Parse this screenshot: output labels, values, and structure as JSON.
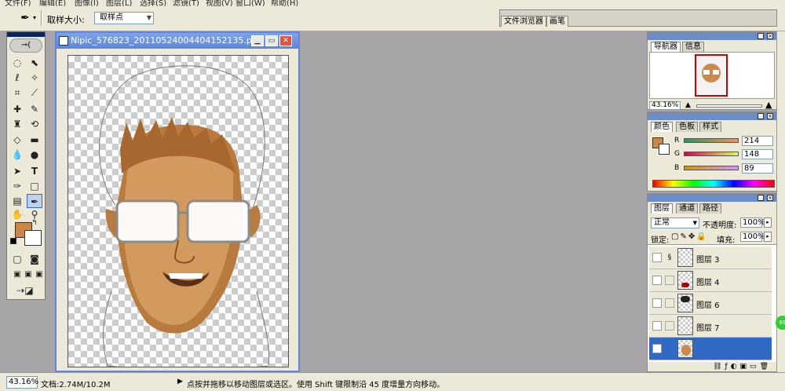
{
  "menu": [
    "文件(F)",
    "编辑(E)",
    "图像(I)",
    "图层(L)",
    "选择(S)",
    "滤镜(T)",
    "视图(V)",
    "窗口(W)",
    "帮助(H)"
  ],
  "options": {
    "label": "取样大小:",
    "sample_value": "取样点"
  },
  "well_tabs": [
    "文件浏览器",
    "画笔"
  ],
  "document": {
    "title": "Nipic_576823_20110524004404152135.psd..."
  },
  "status": {
    "zoom": "43.16%",
    "doc_size": "文档:2.74M/10.2M",
    "tip": "点按并拖移以移动图层或选区。使用 Shift 键限制沿 45 度增量方向移动。"
  },
  "navigator": {
    "tabs": [
      "导航器",
      "信息"
    ],
    "zoom": "43.16%"
  },
  "color": {
    "tabs": [
      "颜色",
      "色板",
      "样式"
    ],
    "r_label": "R",
    "g_label": "G",
    "b_label": "B",
    "r": "214",
    "g": "148",
    "b": "89",
    "fg_color": "#c9874c"
  },
  "layers": {
    "tabs": [
      "图层",
      "通道",
      "路径"
    ],
    "blend_mode": "正常",
    "opacity_label": "不透明度:",
    "opacity": "100%",
    "lock_label": "锁定:",
    "fill_label": "填充:",
    "fill": "100%",
    "items": [
      "图层 3",
      "图层 4",
      "图层 6",
      "图层 7",
      ""
    ]
  },
  "badge": "69"
}
